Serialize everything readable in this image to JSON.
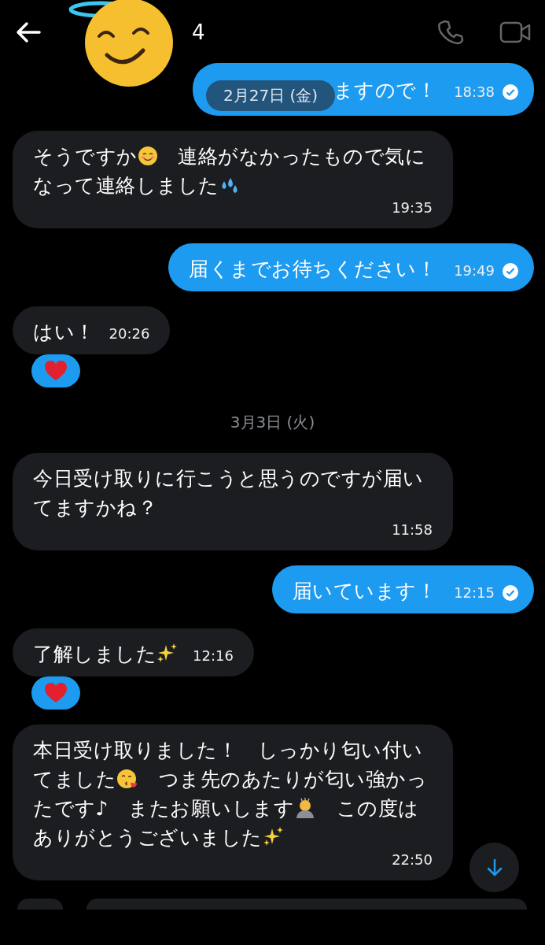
{
  "header": {
    "name": "4"
  },
  "floating_date": "2月27日 (金)",
  "messages": [
    {
      "kind": "out",
      "parts": [
        {
          "kind": "text",
          "text": "ますので！"
        }
      ],
      "time": "18:38",
      "read": true
    },
    {
      "kind": "in",
      "parts": [
        {
          "kind": "text",
          "text": "そうですか"
        },
        {
          "kind": "emoji-smile"
        },
        {
          "kind": "text",
          "text": "　連絡がなかったもので気になって連絡しました"
        },
        {
          "kind": "emoji-sweat"
        }
      ],
      "time": "19:35",
      "reacted": false
    },
    {
      "kind": "out",
      "parts": [
        {
          "kind": "text",
          "text": "届くまでお待ちください！"
        }
      ],
      "time": "19:49",
      "read": true
    },
    {
      "kind": "in",
      "parts": [
        {
          "kind": "text",
          "text": "はい！"
        }
      ],
      "time": "20:26",
      "reacted": true
    },
    {
      "kind": "date",
      "text": "3月3日 (火)"
    },
    {
      "kind": "in",
      "parts": [
        {
          "kind": "text",
          "text": "今日受け取りに行こうと思うのですが届いてますかね？"
        }
      ],
      "time": "11:58",
      "reacted": false
    },
    {
      "kind": "out",
      "parts": [
        {
          "kind": "text",
          "text": "届いています！"
        }
      ],
      "time": "12:15",
      "read": true
    },
    {
      "kind": "in",
      "parts": [
        {
          "kind": "text",
          "text": "了解しました"
        },
        {
          "kind": "emoji-sparkles"
        }
      ],
      "time": "12:16",
      "reacted": true
    },
    {
      "kind": "in",
      "parts": [
        {
          "kind": "text",
          "text": "本日受け取りました！　しっかり匂い付いてました"
        },
        {
          "kind": "emoji-kiss"
        },
        {
          "kind": "text",
          "text": "　つま先のあたりが匂い強かったです♪　またお願いします"
        },
        {
          "kind": "emoji-bow"
        },
        {
          "kind": "text",
          "text": "　この度はありがとうございました"
        },
        {
          "kind": "emoji-sparkles"
        }
      ],
      "time": "22:50",
      "reacted": false
    }
  ]
}
